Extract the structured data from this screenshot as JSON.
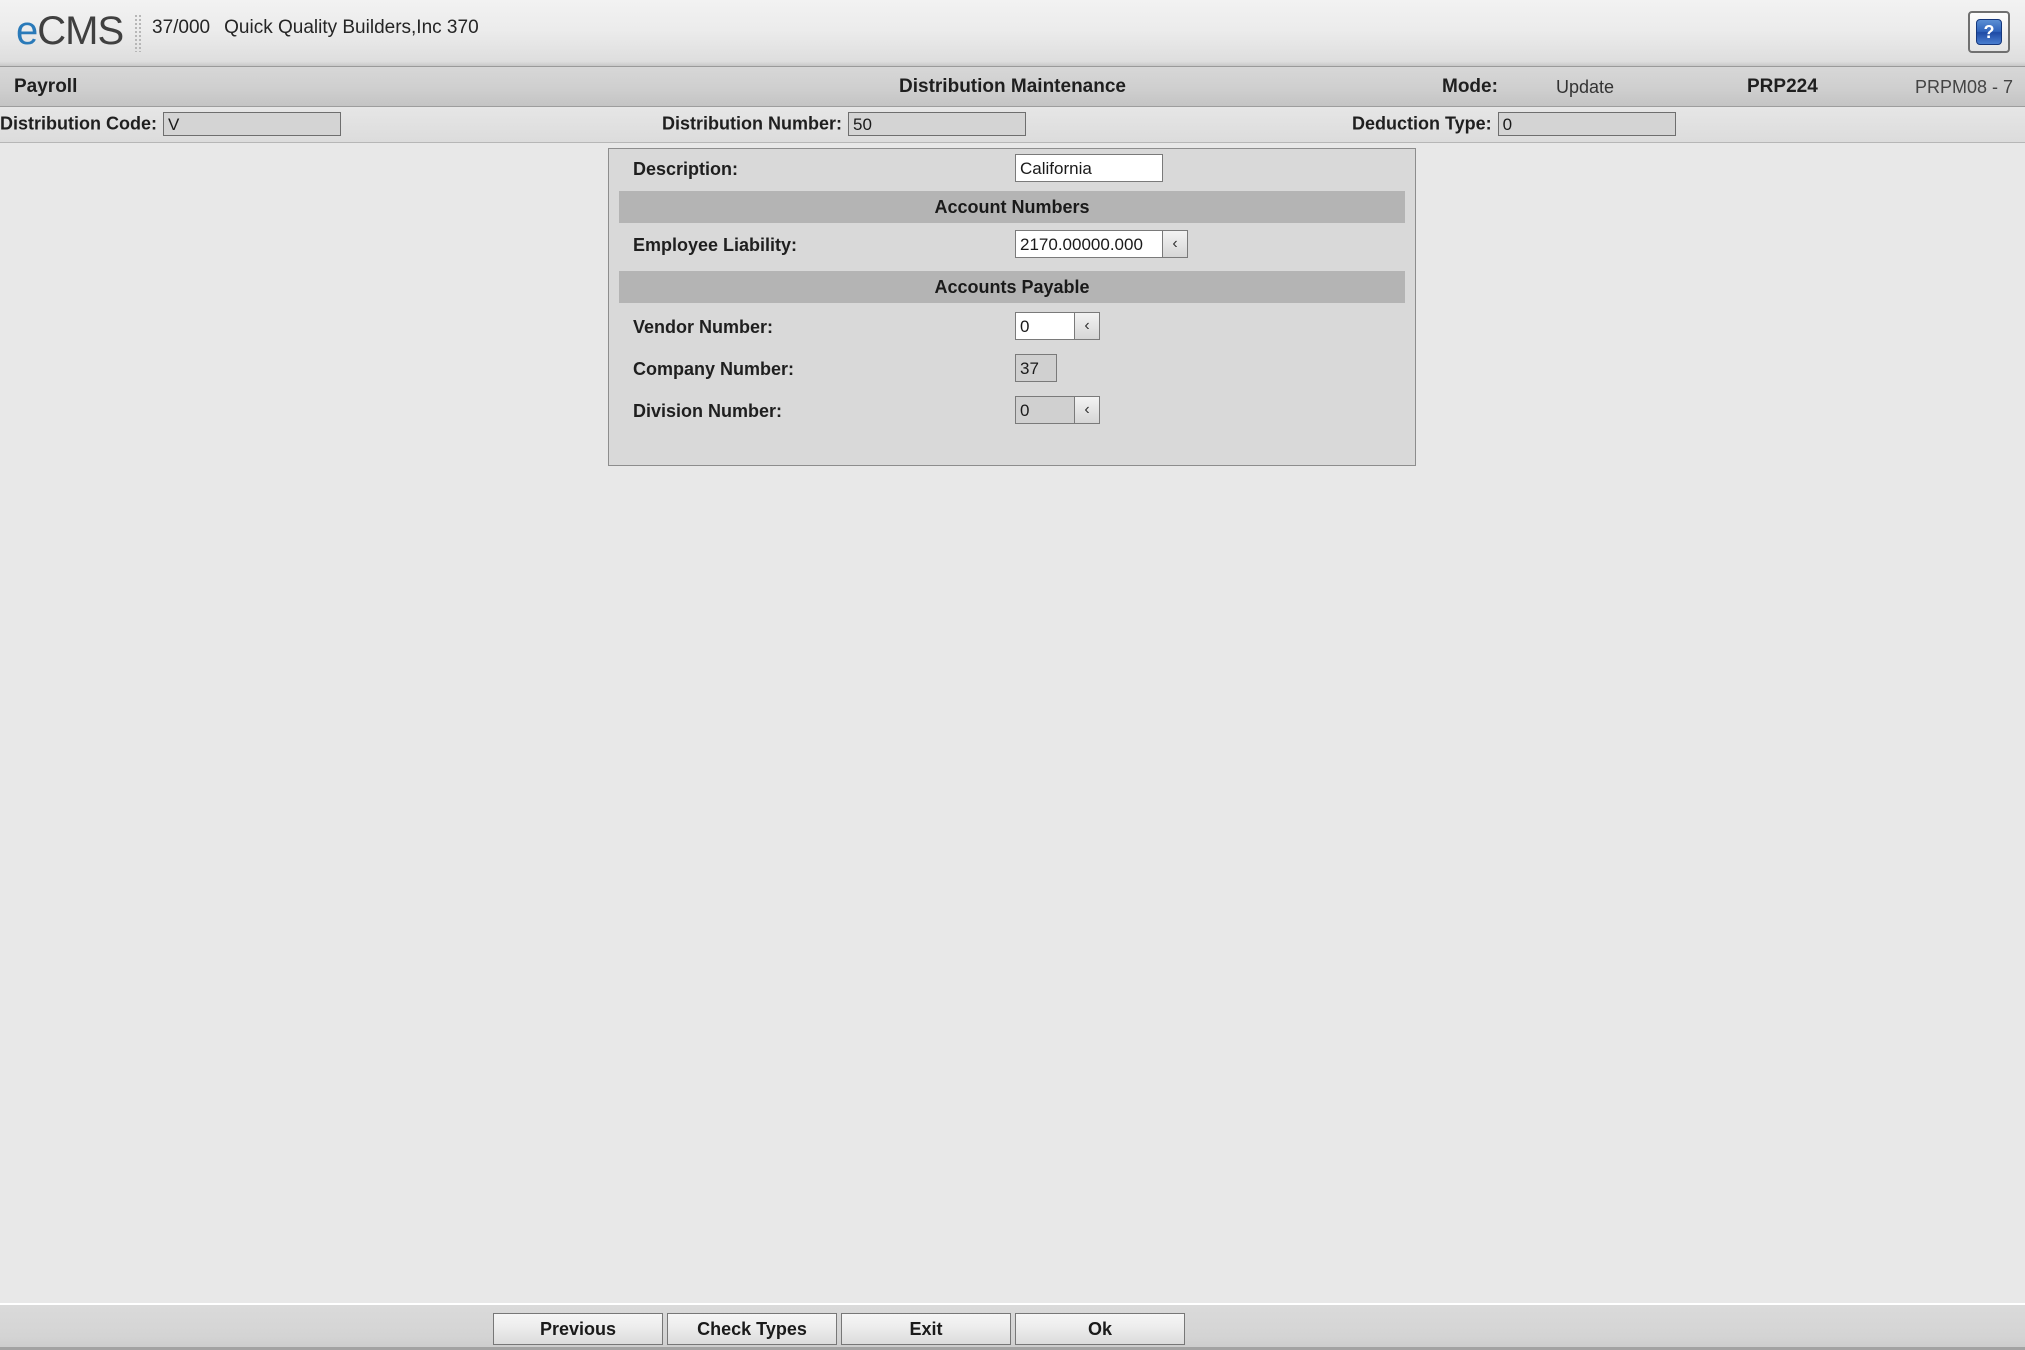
{
  "app_bar": {
    "logo_e": "e",
    "logo_cms": "CMS",
    "company_number": "37/000",
    "company_name": "Quick Quality Builders,Inc 370",
    "help_glyph": "?"
  },
  "module_bar": {
    "module": "Payroll",
    "title": "Distribution Maintenance",
    "mode_label": "Mode:",
    "mode_value": "Update",
    "program_id": "PRP224",
    "screen_id": "PRPM08 - 7"
  },
  "key_bar": {
    "distribution_code": {
      "label": "Distribution Code:",
      "value": "V"
    },
    "distribution_number": {
      "label": "Distribution Number:",
      "value": "50"
    },
    "deduction_type": {
      "label": "Deduction Type:",
      "value": "0"
    }
  },
  "form": {
    "description": {
      "label": "Description:",
      "value": "California"
    },
    "section_account_numbers": "Account Numbers",
    "employee_liability": {
      "label": "Employee Liability:",
      "value": "2170.00000.000",
      "lookup": "‹"
    },
    "section_accounts_payable": "Accounts Payable",
    "vendor_number": {
      "label": "Vendor Number:",
      "value": "0",
      "lookup": "‹"
    },
    "company_number": {
      "label": "Company Number:",
      "value": "37"
    },
    "division_number": {
      "label": "Division Number:",
      "value": "0",
      "lookup": "‹"
    }
  },
  "buttons": [
    {
      "label": "Previous"
    },
    {
      "label": "Check Types"
    },
    {
      "label": "Exit"
    },
    {
      "label": "Ok"
    }
  ],
  "colors": {
    "logo_blue": "#2a7ab9",
    "panel_bg": "#d9d9d9",
    "section_bar": "#b4b4b4",
    "work_area": "#e8e8e8",
    "help_blue": "#2f63bb"
  }
}
